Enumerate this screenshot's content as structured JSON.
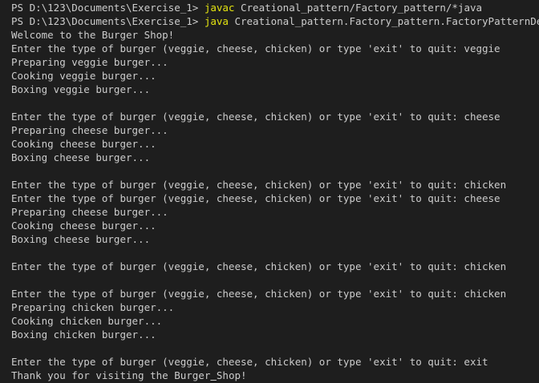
{
  "theme": {
    "background": "#1e1e1e",
    "foreground": "#cccccc",
    "command_color": "#e5e510"
  },
  "lines": [
    {
      "type": "prompt",
      "prompt": "PS D:\\123\\Documents\\Exercise_1> ",
      "cmd": "javac",
      "args": " Creational_pattern/Factory_pattern/*java"
    },
    {
      "type": "prompt",
      "prompt": "PS D:\\123\\Documents\\Exercise_1> ",
      "cmd": "java",
      "args": " Creational_pattern.Factory_pattern.FactoryPatternDemo"
    },
    {
      "type": "text",
      "text": "Welcome to the Burger Shop!"
    },
    {
      "type": "text",
      "text": "Enter the type of burger (veggie, cheese, chicken) or type 'exit' to quit: veggie"
    },
    {
      "type": "text",
      "text": "Preparing veggie burger..."
    },
    {
      "type": "text",
      "text": "Cooking veggie burger..."
    },
    {
      "type": "text",
      "text": "Boxing veggie burger..."
    },
    {
      "type": "text",
      "text": ""
    },
    {
      "type": "text",
      "text": "Enter the type of burger (veggie, cheese, chicken) or type 'exit' to quit: cheese"
    },
    {
      "type": "text",
      "text": "Preparing cheese burger..."
    },
    {
      "type": "text",
      "text": "Cooking cheese burger..."
    },
    {
      "type": "text",
      "text": "Boxing cheese burger..."
    },
    {
      "type": "text",
      "text": ""
    },
    {
      "type": "text",
      "text": "Enter the type of burger (veggie, cheese, chicken) or type 'exit' to quit: chicken"
    },
    {
      "type": "text",
      "text": "Enter the type of burger (veggie, cheese, chicken) or type 'exit' to quit: cheese"
    },
    {
      "type": "text",
      "text": "Preparing cheese burger..."
    },
    {
      "type": "text",
      "text": "Cooking cheese burger..."
    },
    {
      "type": "text",
      "text": "Boxing cheese burger..."
    },
    {
      "type": "text",
      "text": ""
    },
    {
      "type": "text",
      "text": "Enter the type of burger (veggie, cheese, chicken) or type 'exit' to quit: chicken"
    },
    {
      "type": "text",
      "text": ""
    },
    {
      "type": "text",
      "text": "Enter the type of burger (veggie, cheese, chicken) or type 'exit' to quit: chicken"
    },
    {
      "type": "text",
      "text": "Preparing chicken burger..."
    },
    {
      "type": "text",
      "text": "Cooking chicken burger..."
    },
    {
      "type": "text",
      "text": "Boxing chicken burger..."
    },
    {
      "type": "text",
      "text": ""
    },
    {
      "type": "text",
      "text": "Enter the type of burger (veggie, cheese, chicken) or type 'exit' to quit: exit"
    },
    {
      "type": "final",
      "before": "Thank you for visiting the Burger",
      "cursor_char": " ",
      "after": "Shop!"
    }
  ]
}
